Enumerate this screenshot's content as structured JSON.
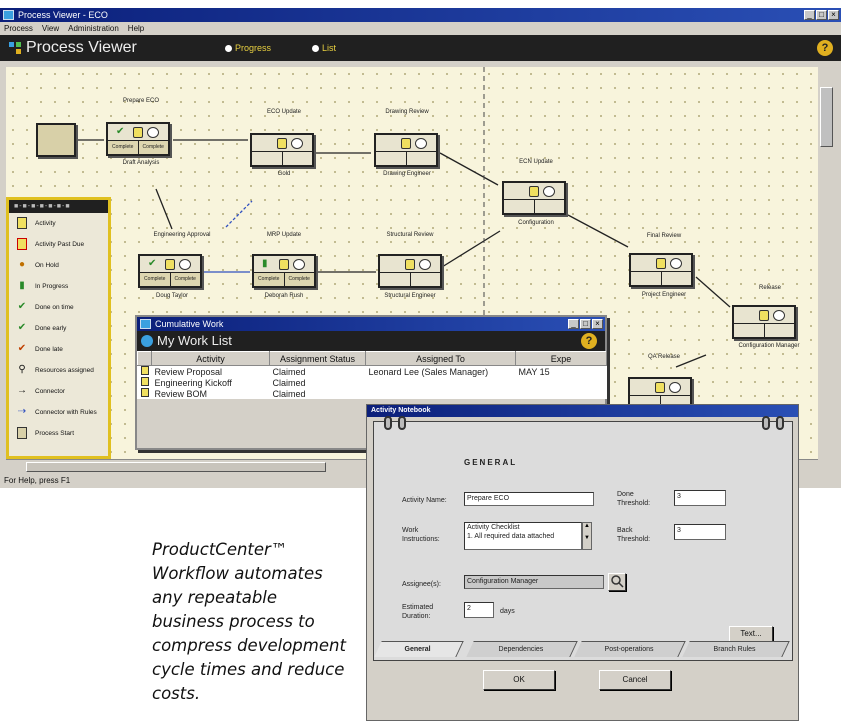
{
  "process_viewer": {
    "window_title": "Process Viewer - ECO",
    "menus": [
      "Process",
      "View",
      "Administration",
      "Help"
    ],
    "header_title": "Process Viewer",
    "radio_1": "Progress",
    "radio_2": "List",
    "help_glyph": "?",
    "status_text": "For Help, press F1",
    "nodes": [
      {
        "name": "Prepare ECO",
        "sub": "Draft Analysis",
        "cell1": "Complete",
        "cell2": "Complete"
      },
      {
        "name": "ECO Update",
        "sub": "Gold"
      },
      {
        "name": "Drawing Review",
        "sub": "Drawing Engineer"
      },
      {
        "name": "Engineering Approval",
        "sub": "Doug Taylor",
        "cell1": "Complete",
        "cell2": "Complete"
      },
      {
        "name": "MRP Update",
        "sub": "Deborah Rush",
        "cell1": "Complete",
        "cell2": "Complete"
      },
      {
        "name": "Structural Review",
        "sub": "Structural Engineer"
      },
      {
        "name": "ECN Update",
        "sub": "Configuration"
      },
      {
        "name": "Final Review",
        "sub": "Project Engineer"
      },
      {
        "name": "Release",
        "sub": "Configuration Manager"
      },
      {
        "name": "QA Release",
        "sub": ""
      }
    ],
    "palette": {
      "items": [
        "Activity",
        "Activity Past Due",
        "On Hold",
        "In Progress",
        "Done on time",
        "Done early",
        "Done late",
        "Resources assigned",
        "Connector",
        "Connector with Rules",
        "Process Start"
      ],
      "icons": [
        "activity-icon",
        "activity-past-due-icon",
        "on-hold-icon",
        "in-progress-icon",
        "done-on-time-icon",
        "done-early-icon",
        "done-late-icon",
        "resources-assigned-icon",
        "connector-icon",
        "connector-with-rules-icon",
        "process-start-icon"
      ]
    }
  },
  "worklist": {
    "window_title": "Cumulative Work",
    "header": "My Work List",
    "help_glyph": "?",
    "columns": [
      "Activity",
      "Assignment Status",
      "Assigned To",
      "Expe"
    ],
    "rows": [
      [
        "Review Proposal",
        "Claimed",
        "Leonard Lee (Sales Manager)",
        "MAY 15"
      ],
      [
        "Engineering Kickoff",
        "Claimed",
        "",
        ""
      ],
      [
        "Review BOM",
        "Claimed",
        "",
        ""
      ]
    ]
  },
  "notebook": {
    "window_title": "Activity Notebook",
    "section": "GENERAL",
    "activity_name_label": "Activity Name:",
    "activity_name_value": "Prepare ECO",
    "work_instructions_label": "Work Instructions:",
    "work_instructions_lines": [
      "Activity Checklist",
      "1. All required data attached"
    ],
    "assignee_label": "Assignee(s):",
    "assignee_value": "Configuration Manager",
    "estimated_duration_label": "Estimated Duration:",
    "estimated_duration_value": "2",
    "days_label": "days",
    "done_threshold_label": "Done Threshold:",
    "done_threshold_value": "3",
    "back_threshold_label": "Back Threshold:",
    "back_threshold_value": "3",
    "text_button": "Text...",
    "tabs": [
      "General",
      "Dependencies",
      "Post-operations",
      "Branch Rules"
    ],
    "ok_button": "OK",
    "cancel_button": "Cancel"
  },
  "caption": {
    "text": "ProductCenter™ Workflow automates any repeatable business process to compress development cycle times and reduce costs."
  },
  "colors": {
    "title_bar": "#0b1f7a",
    "header_bg": "#202020",
    "canvas_bg": "#f8f4dc",
    "palette_border": "#e0c020",
    "done_green": "#2a8a2a"
  }
}
